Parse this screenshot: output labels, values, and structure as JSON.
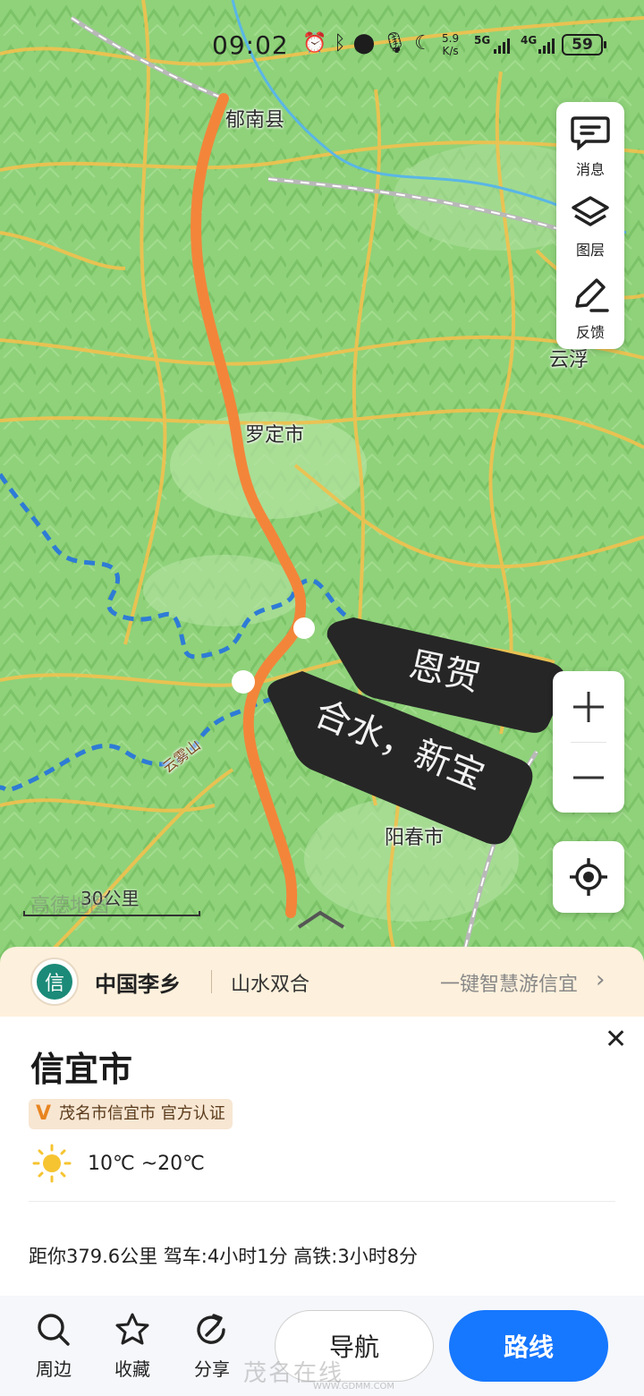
{
  "status_bar": {
    "time": "09:02",
    "net_speed_value": "5.9",
    "net_speed_unit": "K/s",
    "signal_1": "5G",
    "signal_2": "4G",
    "battery": "59"
  },
  "map": {
    "labels": {
      "yunan": "郁南县",
      "luoding": "罗定市",
      "yunfu": "云浮",
      "yangchun": "阳春市",
      "yunwushan": "云雾山"
    },
    "annotations": {
      "enhe": "恩贺",
      "heshui": "合水，新宝"
    },
    "scale_text": "30公里",
    "logo_watermark": "高德地图",
    "colors": {
      "route": "#f3853a",
      "border": "#2e7bd6",
      "water": "#5ab6e6",
      "road": "#f2c14e"
    }
  },
  "side_panel": {
    "messages": "消息",
    "layers": "图层",
    "feedback": "反馈"
  },
  "banner": {
    "badge_char": "信",
    "title": "中国李乡",
    "subtitle": "山水双合",
    "link": "一键智慧游信宜"
  },
  "card": {
    "title": "信宜市",
    "verify_mark": "V",
    "verify": "茂名市信宜市 官方认证",
    "weather": "10℃ ~20℃",
    "distance": "距你379.6公里 驾车:4小时1分 高铁:3小时8分"
  },
  "actions": {
    "nearby": "周边",
    "favorite": "收藏",
    "share": "分享",
    "navigate": "导航",
    "route": "路线"
  },
  "watermark": {
    "site": "茂名在线",
    "url": "WWW.GDMM.COM"
  }
}
